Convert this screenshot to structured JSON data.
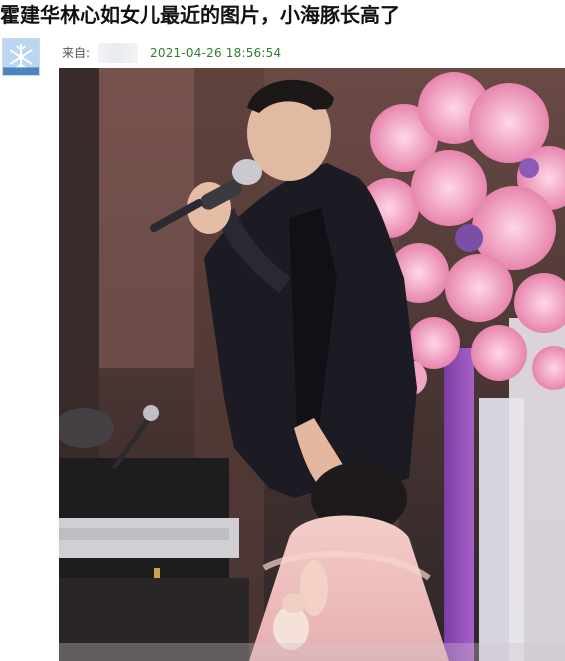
{
  "article": {
    "title": "霍建华林心如女儿最近的图片，小海豚长高了",
    "from_label": "来自:",
    "timestamp": "2021-04-26 18:56:54"
  },
  "colors": {
    "timestamp": "#2e7d32",
    "title": "#111111"
  },
  "icons": {
    "avatar": "snowflake-avatar-icon",
    "photo": "stage-performance-photo"
  }
}
